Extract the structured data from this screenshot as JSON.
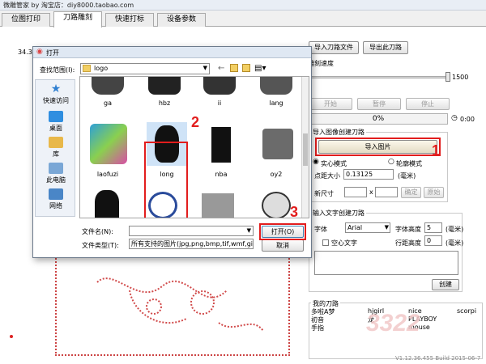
{
  "app": {
    "title": "微雕管家 by 淘宝店：diy8000.taobao.com"
  },
  "tabs": [
    {
      "label": "位图打印"
    },
    {
      "label": "刀路雕刻"
    },
    {
      "label": "快速打标"
    },
    {
      "label": "设备参数"
    }
  ],
  "canvas": {
    "coord_label": "34.3"
  },
  "right_panel": {
    "import_path_label": "导入刀路文件",
    "export_path_label": "导出此刀路",
    "speed_label": "雕刻速度",
    "speed_value": "1500",
    "start_label": "开始",
    "pause_label": "暂停",
    "stop_label": "停止",
    "progress_text": "0%",
    "time_text": "0:00",
    "image_group_title": "导入图像创建刀路",
    "import_image_label": "导入图片",
    "solid_mode_label": "实心模式",
    "outline_mode_label": "轮廓模式",
    "dot_size_label": "点距大小",
    "dot_size_value": "0.13125",
    "mm_unit": "(毫米)",
    "new_size_label": "新尺寸",
    "times_sign": "x",
    "confirm_label": "确定",
    "original_label": "原始",
    "text_group_title": "输入文字创建刀路",
    "font_label": "字体",
    "font_value": "Arial",
    "font_height_label": "字体高度",
    "font_height_value": "5",
    "hollow_label": "空心文字",
    "line_spacing_label": "行距高度",
    "line_spacing_value": "0",
    "create_label": "创建",
    "my_paths_title": "我的刀路",
    "my_paths": [
      [
        "多啦A梦",
        "hjgirl",
        "nice",
        "scorpi"
      ],
      [
        "初音",
        "龙",
        "PLAYBOY",
        ""
      ],
      [
        "手指",
        "",
        "mouse",
        ""
      ]
    ],
    "version_text": "V1.12.36.455 Build 2015-06-7"
  },
  "dialog": {
    "title": "打开",
    "lookin_label": "查找范围(I):",
    "lookin_value": "logo",
    "places": [
      {
        "label": "快速访问",
        "icon": "star-icon"
      },
      {
        "label": "桌面",
        "icon": "desktop-icon"
      },
      {
        "label": "库",
        "icon": "library-icon"
      },
      {
        "label": "此电脑",
        "icon": "computer-icon"
      },
      {
        "label": "网络",
        "icon": "network-icon"
      }
    ],
    "files_row1": [
      "ga",
      "hbz",
      "ii",
      "lang"
    ],
    "files_row2": [
      "laofuzi",
      "long",
      "nba",
      "oy2"
    ],
    "filename_label": "文件名(N):",
    "filetype_label": "文件类型(T):",
    "filetype_value": "所有支持的图片(jpg,png,bmp,tif,wmf,gi",
    "open_label": "打开(O)",
    "cancel_label": "取消"
  },
  "annotations": {
    "n1": "1",
    "n2": "2",
    "n3": "3"
  },
  "watermark": {
    "text": "3322"
  },
  "colors": {
    "accent_red": "#e21d1d",
    "selection": "#cfe3f7",
    "progress_track": "#f3f3f3"
  }
}
